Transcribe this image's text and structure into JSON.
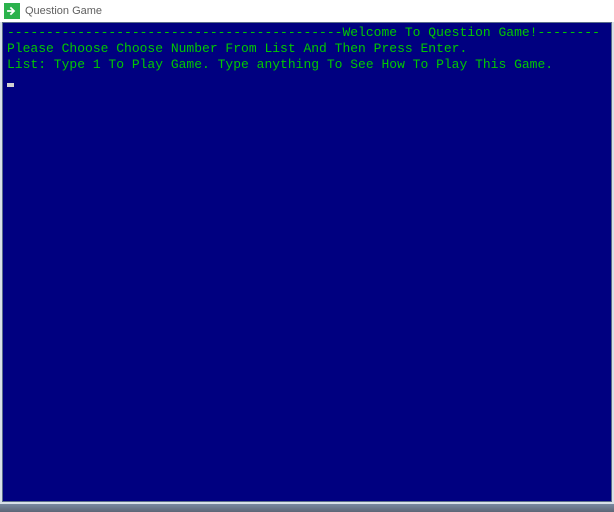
{
  "window": {
    "title": "Question Game"
  },
  "console": {
    "line1": "-------------------------------------------Welcome To Question Game!--------",
    "line2": "Please Choose Choose Number From List And Then Press Enter.",
    "line3": "List: Type 1 To Play Game. Type anything To See How To Play This Game."
  }
}
